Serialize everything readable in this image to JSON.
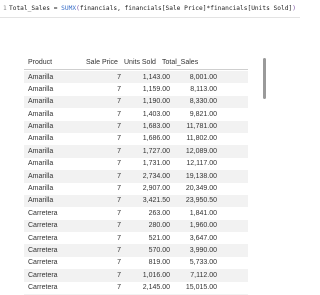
{
  "formula": {
    "line_number": "1",
    "measure": "Total_Sales",
    "equals": " = ",
    "function": "SUMX",
    "open_paren": "(",
    "arg1": "financials, financials",
    "arg2": "[Sale Price]",
    "star": "*",
    "arg3": "financials",
    "arg4": "[Units Sold]",
    "close_paren": ")"
  },
  "table": {
    "headers": [
      "Product",
      "Sale Price",
      "Units Sold",
      "Total_Sales"
    ],
    "rows": [
      [
        "Amarilla",
        "7",
        "1,143.00",
        "8,001.00"
      ],
      [
        "Amarilla",
        "7",
        "1,159.00",
        "8,113.00"
      ],
      [
        "Amarilla",
        "7",
        "1,190.00",
        "8,330.00"
      ],
      [
        "Amarilla",
        "7",
        "1,403.00",
        "9,821.00"
      ],
      [
        "Amarilla",
        "7",
        "1,683.00",
        "11,781.00"
      ],
      [
        "Amarilla",
        "7",
        "1,686.00",
        "11,802.00"
      ],
      [
        "Amarilla",
        "7",
        "1,727.00",
        "12,089.00"
      ],
      [
        "Amarilla",
        "7",
        "1,731.00",
        "12,117.00"
      ],
      [
        "Amarilla",
        "7",
        "2,734.00",
        "19,138.00"
      ],
      [
        "Amarilla",
        "7",
        "2,907.00",
        "20,349.00"
      ],
      [
        "Amarilla",
        "7",
        "3,421.50",
        "23,950.50"
      ],
      [
        "Carretera",
        "7",
        "263.00",
        "1,841.00"
      ],
      [
        "Carretera",
        "7",
        "280.00",
        "1,960.00"
      ],
      [
        "Carretera",
        "7",
        "521.00",
        "3,647.00"
      ],
      [
        "Carretera",
        "7",
        "570.00",
        "3,990.00"
      ],
      [
        "Carretera",
        "7",
        "819.00",
        "5,733.00"
      ],
      [
        "Carretera",
        "7",
        "1,016.00",
        "7,112.00"
      ],
      [
        "Carretera",
        "7",
        "2,145.00",
        "15,015.00"
      ],
      [
        "Carretera",
        "7",
        "2,487.00",
        "17,409.00"
      ]
    ]
  }
}
